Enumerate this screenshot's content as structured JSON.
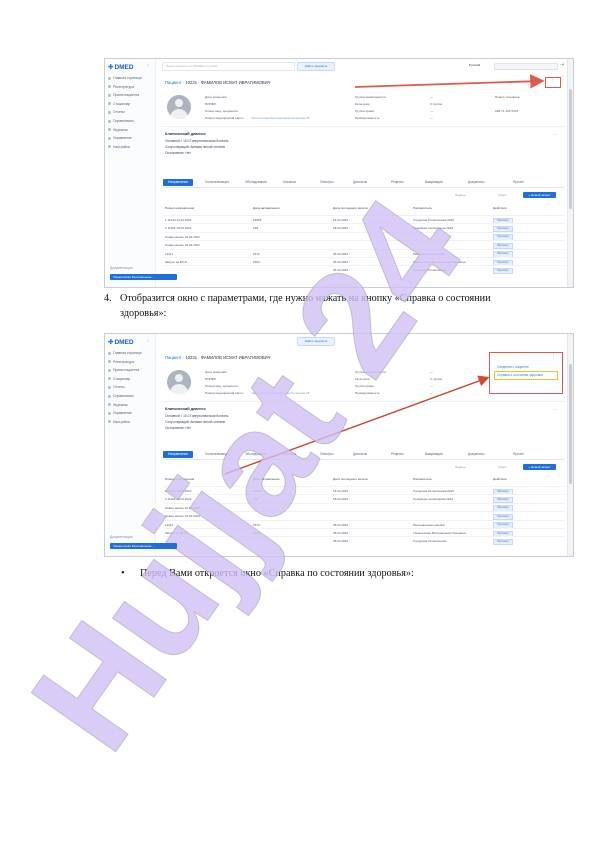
{
  "doc": {
    "step4_number": "4.",
    "step4_text": "Отобразится окно с параметрами, где нужно нажать на кнопку «Справка о состоянии здоровья»:",
    "bullet_symbol": "•",
    "bullet_text": "Перед Вами откроется окно «Справка по состоянии здоровья»:",
    "watermark_text": "Hujjat 24"
  },
  "app": {
    "logo": "DMED",
    "collapse_icon": "chevron-left-icon",
    "search_placeholder": "Поиск пациента по ПИНФЛ или ФИО",
    "top_button": "Найти пациента",
    "lang": "Русский",
    "exit_icon": "logout-icon",
    "nav_items": [
      "Главная страница",
      "Регистратура",
      "Прием пациента",
      "Стационар",
      "Отчеты",
      "Справочники",
      "Журналы",
      "Управление",
      "Настройки"
    ],
    "side_footer": "Документация",
    "side_button": "Ташкентская Региональная ...",
    "patient_label": "Пациент",
    "patient_id": "10231",
    "patient_name": "ФАМИЛОВ ИСМАТ ИБРАГИМОВИЧ",
    "info_col1": [
      "Дата рождения",
      "ПИНФЛ",
      "Номер мед. документа",
      "Номер медицинской карты"
    ],
    "info_col1_accent": "Ташкентская Региональная больница 25",
    "info_col2": [
      "Группа инвалидности",
      "Категория",
      "Группа крови",
      "Принадлежность"
    ],
    "info_col3": [
      "—",
      "3 группа",
      "—",
      "—"
    ],
    "info_col4": [
      "Номер телефона",
      "",
      "998 71 234 5678",
      ""
    ],
    "section_title": "Клинический диагноз",
    "section_lines": [
      "Основной: I 10.0 Гипертоническая болезнь",
      "Сопутствующий: Анемия легкой степени",
      "Осложнение: Нет"
    ],
    "tabs": [
      "Направления",
      "Госпитализация",
      "Обследования",
      "Анализы",
      "Осмотры",
      "Диагнозы",
      "Рецепты",
      "Вакцинация",
      "Документы",
      "Прочее"
    ],
    "filter_label": "Период",
    "reset_label": "Сброс",
    "new_request": "+ Новый запрос",
    "table_headers": [
      "Номер направления",
      "Дата направления",
      "Дата последнего визита",
      "Направитель",
      "Действия"
    ],
    "rows": [
      {
        "c1": "1 11234 14.04.2023",
        "c2": "14653",
        "c3": "14.04.2023",
        "c4": "Городская Поликлиника №25",
        "badge": "Просмотр"
      },
      {
        "c1": "2 11301 18.04.2023",
        "c2": "128",
        "c3": "18.04.2023",
        "c4": "Семейная поликлиника №14",
        "badge": "Просмотр"
      },
      {
        "c1": "Новая запись 23.04.2023",
        "c2": "",
        "c3": "",
        "c4": "",
        "badge": "Просмотр"
      },
      {
        "c1": "Новая запись 24.04.2023",
        "c2": "",
        "c3": "",
        "c4": "",
        "badge": "Просмотр"
      },
      {
        "c1": "11421",
        "c2": "1573",
        "c3": "25.04.2023",
        "c4": "Региональная клиника",
        "badge": "Просмотр"
      },
      {
        "c1": "Запрос на МСЭ",
        "c2": "1554",
        "c3": "25.04.2023",
        "c4": "Ташкентская Региональная больница",
        "badge": "Просмотр"
      },
      {
        "c1": "",
        "c2": "",
        "c3": "25.04.2023",
        "c4": "Городская Поликлиника",
        "badge": "Просмотр"
      }
    ],
    "kebab_icon": "more-vertical-icon",
    "dropdown_items": [
      "Сведения о пациенте",
      "Справка о состоянии здоровья"
    ]
  },
  "colors": {
    "accent": "#1e6fd9",
    "highlight_red": "#e05a4a",
    "highlight_yellow": "#f2c02e",
    "watermark": "#d0bff4"
  }
}
